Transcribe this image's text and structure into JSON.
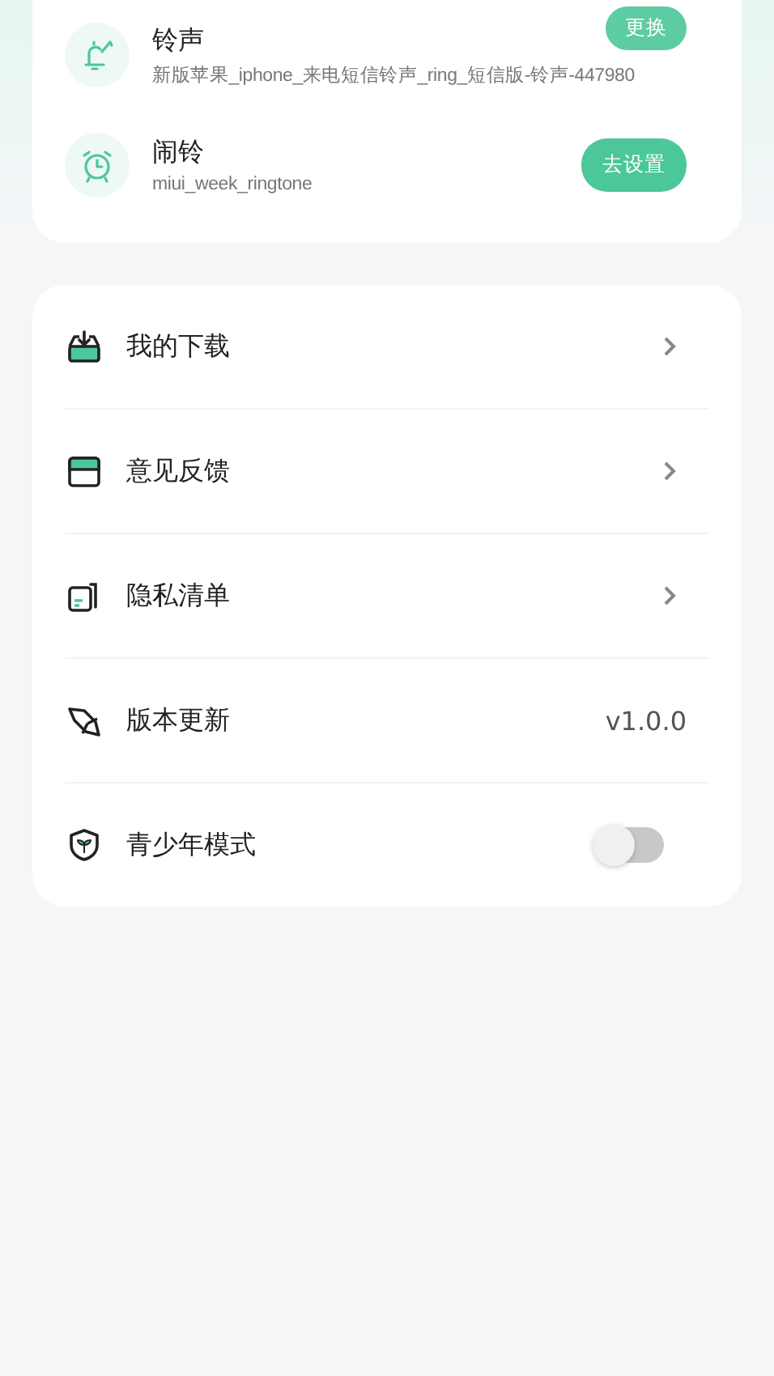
{
  "sound_settings": [
    {
      "title": "铃声",
      "subtitle": "新版苹果_iphone_来电短信铃声_ring_短信版-铃声-447980",
      "button": "更换"
    },
    {
      "title": "闹铃",
      "subtitle": "miui_week_ringtone",
      "button": "去设置"
    }
  ],
  "menu": [
    {
      "label": "我的下载",
      "kind": "chevron"
    },
    {
      "label": "意见反馈",
      "kind": "chevron"
    },
    {
      "label": "隐私清单",
      "kind": "chevron"
    },
    {
      "label": "版本更新",
      "kind": "value",
      "value": "v1.0.0"
    },
    {
      "label": "青少年模式",
      "kind": "toggle",
      "on": false
    }
  ]
}
